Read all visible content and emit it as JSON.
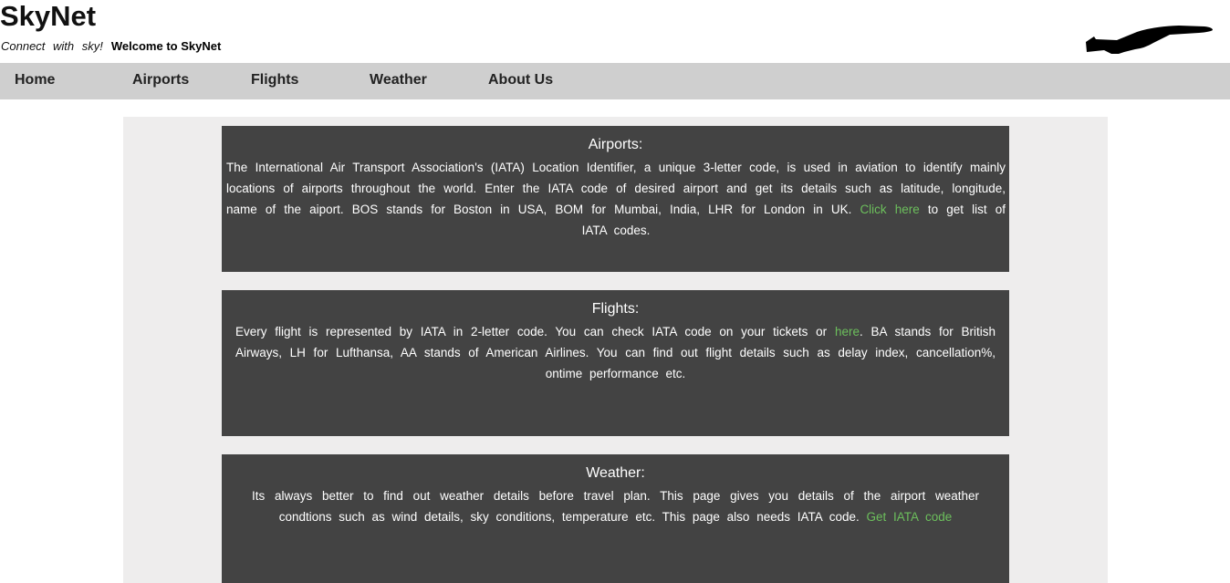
{
  "header": {
    "site_title": "SkyNet",
    "tagline": "Connect with sky!",
    "welcome": "Welcome to SkyNet",
    "logo_icon": "airplane-icon"
  },
  "nav": {
    "items": [
      {
        "label": "Home"
      },
      {
        "label": "Airports"
      },
      {
        "label": "Flights"
      },
      {
        "label": "Weather"
      },
      {
        "label": "About Us"
      }
    ]
  },
  "colors": {
    "nav_background": "#cfcfcf",
    "card_background": "#434343",
    "main_background": "#eeeded",
    "link_color": "#6cbf5c"
  },
  "cards": {
    "airports": {
      "title": "Airports:",
      "text_1": "The International Air Transport Association's (IATA) Location Identifier, a unique 3-letter code, is used in aviation to identify mainly locations of airports throughout the world. Enter the IATA code of desired airport and get its details such as latitude, longitude, name of the aiport. BOS stands for Boston in USA, BOM for Mumbai, India, LHR for London in UK. ",
      "link": "Click here",
      "text_2": " to get list of IATA codes."
    },
    "flights": {
      "title": "Flights:",
      "text_1": "Every flight is represented by IATA in 2-letter code. You can check IATA code on your tickets or ",
      "link": "here",
      "text_2": ". BA stands for British Airways, LH for Lufthansa, AA stands of American Airlines. You can find out flight details such as delay index, cancellation%, ontime performance etc."
    },
    "weather": {
      "title": "Weather:",
      "text_1": "Its always better to find out weather details before travel plan. This page gives you details of the airport weather condtions such as wind details, sky conditions, temperature etc. This page also needs IATA code. ",
      "link": "Get IATA code"
    }
  }
}
